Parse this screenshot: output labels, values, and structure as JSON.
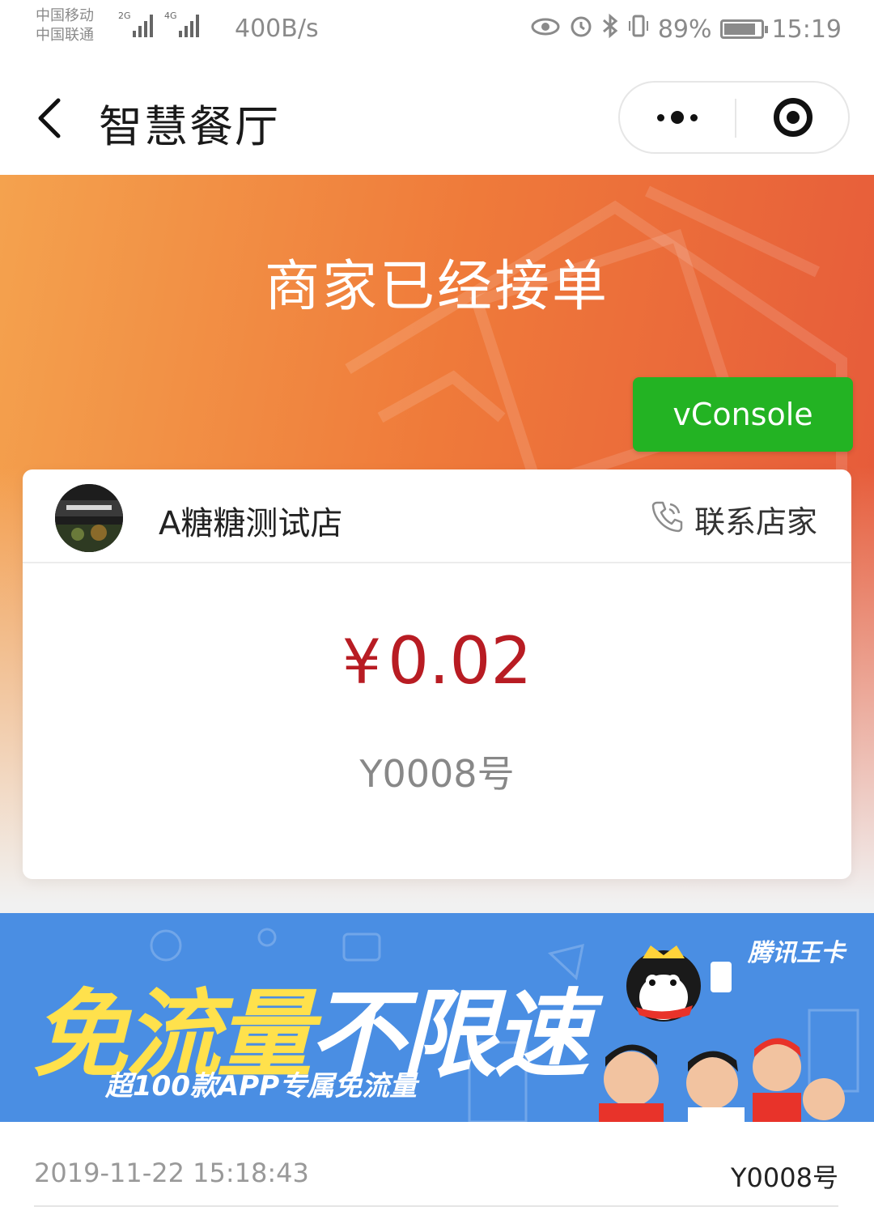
{
  "status_bar": {
    "carrier_1": "中国移动",
    "carrier_2": "中国联通",
    "signal_1_tag": "2G",
    "signal_2_tag": "4G",
    "net_speed": "400B/s",
    "battery": "89%",
    "time": "15:19",
    "icons": [
      "eye-icon",
      "alarm-icon",
      "bluetooth-icon",
      "vibrate-icon",
      "battery-icon"
    ]
  },
  "navbar": {
    "title": "智慧餐厅",
    "back_icon": "chevron-left-icon",
    "more_icon": "more-dots-icon",
    "close_icon": "target-circle-icon"
  },
  "hero": {
    "title": "商家已经接单"
  },
  "vconsole": {
    "label": "vConsole",
    "color": "#23b323"
  },
  "order_card": {
    "shop_name": "A糖糖测试店",
    "contact_label": "联系店家",
    "currency": "¥",
    "amount": "0.02",
    "order_no": "Y0008号",
    "amount_color": "#b81c23"
  },
  "banner": {
    "headline_yellow": "免流量",
    "headline_white": "不限速",
    "subline": "超100款APP专属免流量",
    "brand": "腾讯王卡"
  },
  "order_info": {
    "time": "2019-11-22 15:18:43",
    "order_no": "Y0008号"
  },
  "colors": {
    "hero_gradient_start": "#f4a24e",
    "hero_gradient_end": "#e5573a",
    "banner_bg": "#4a8ee3"
  }
}
